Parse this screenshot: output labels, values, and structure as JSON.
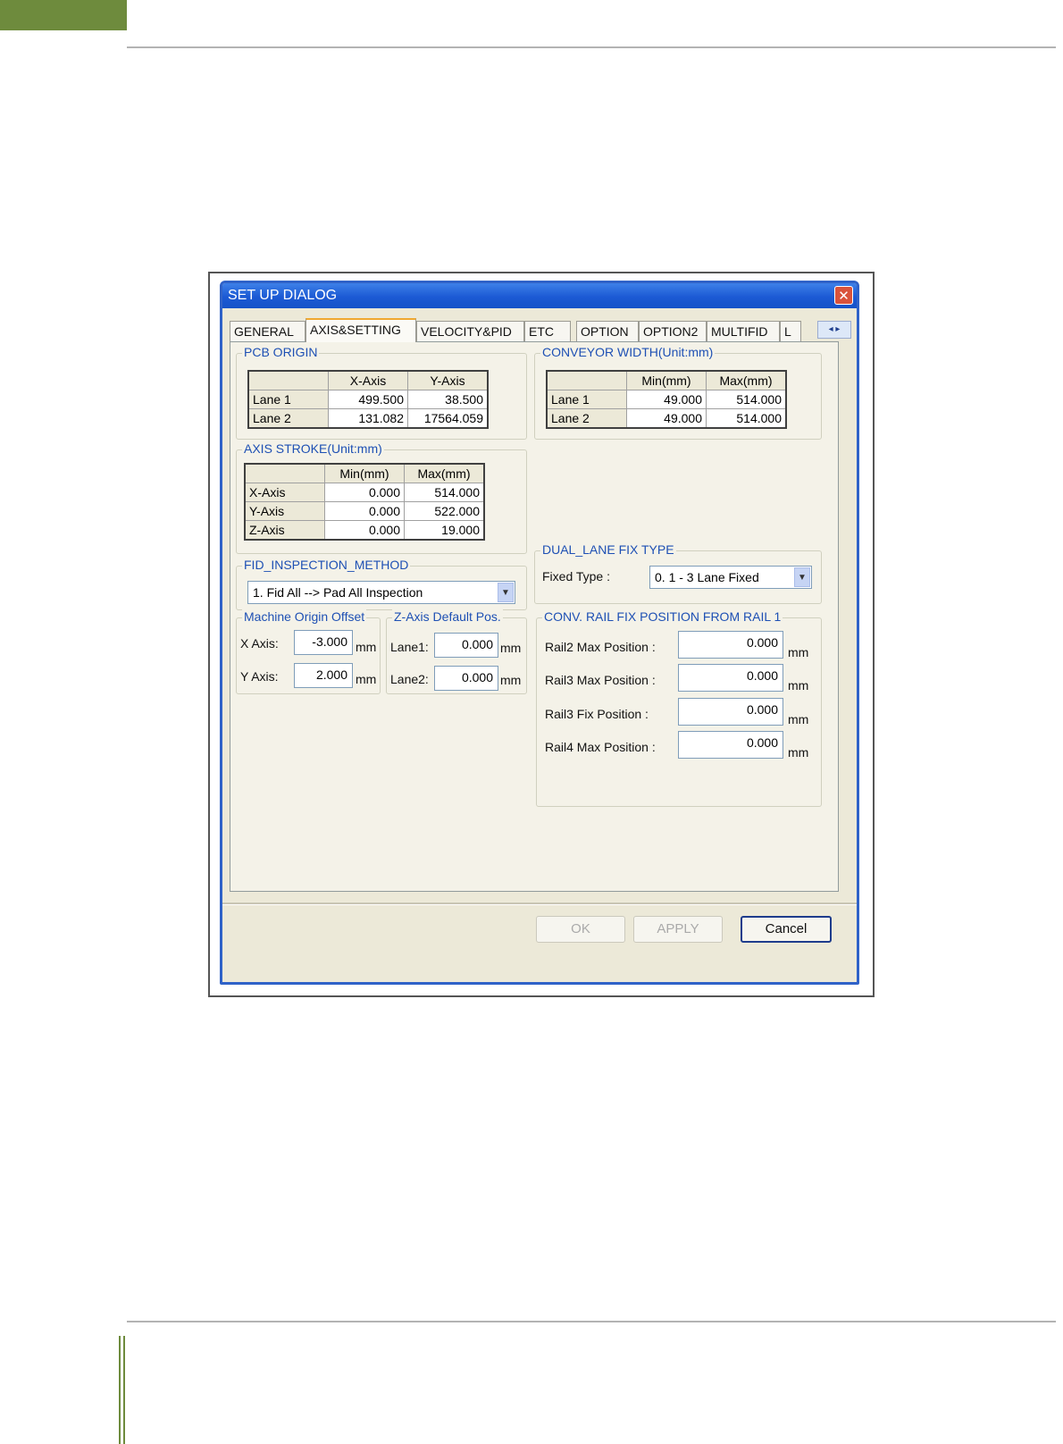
{
  "dialog": {
    "title": "SET UP DIALOG",
    "tabs": [
      "GENERAL",
      "AXIS&SETTING",
      "VELOCITY&PID",
      "ETC",
      "OPTION",
      "OPTION2",
      "MULTIFID",
      "L"
    ],
    "active_tab": "AXIS&SETTING",
    "tab_scroll": "◂ ▸"
  },
  "pcb_origin": {
    "label": "PCB ORIGIN",
    "columns": [
      "",
      "X-Axis",
      "Y-Axis"
    ],
    "rows": [
      [
        "Lane 1",
        "499.500",
        "38.500"
      ],
      [
        "Lane 2",
        "131.082",
        "17564.059"
      ]
    ]
  },
  "conveyor_width": {
    "label": "CONVEYOR WIDTH(Unit:mm)",
    "columns": [
      "",
      "Min(mm)",
      "Max(mm)"
    ],
    "rows": [
      [
        "Lane 1",
        "49.000",
        "514.000"
      ],
      [
        "Lane 2",
        "49.000",
        "514.000"
      ]
    ]
  },
  "axis_stroke": {
    "label": "AXIS STROKE(Unit:mm)",
    "columns": [
      "",
      "Min(mm)",
      "Max(mm)"
    ],
    "rows": [
      [
        "X-Axis",
        "0.000",
        "514.000"
      ],
      [
        "Y-Axis",
        "0.000",
        "522.000"
      ],
      [
        "Z-Axis",
        "0.000",
        "19.000"
      ]
    ]
  },
  "fid_inspection": {
    "label": "FID_INSPECTION_METHOD",
    "selected": "1. Fid All --> Pad All Inspection"
  },
  "dual_lane": {
    "label": "DUAL_LANE FIX TYPE",
    "field_label": "Fixed Type :",
    "selected": "0. 1 - 3 Lane Fixed"
  },
  "machine_origin": {
    "label": "Machine Origin Offset",
    "x_label": "X Axis:",
    "x_value": "-3.000",
    "y_label": "Y Axis:",
    "y_value": "2.000",
    "unit": "mm"
  },
  "z_axis_default": {
    "label": "Z-Axis Default Pos.",
    "lane1_label": "Lane1:",
    "lane1_value": "0.000",
    "lane2_label": "Lane2:",
    "lane2_value": "0.000",
    "unit": "mm"
  },
  "conv_rail": {
    "label": "CONV. RAIL FIX POSITION FROM RAIL 1",
    "unit": "mm",
    "items": [
      {
        "label": "Rail2 Max Position :",
        "value": "0.000"
      },
      {
        "label": "Rail3 Max Position :",
        "value": "0.000"
      },
      {
        "label": "Rail3 Fix Position :",
        "value": "0.000"
      },
      {
        "label": "Rail4 Max Position :",
        "value": "0.000"
      }
    ]
  },
  "buttons": {
    "ok": "OK",
    "apply": "APPLY",
    "cancel": "Cancel"
  },
  "icons": {
    "close": "close-icon",
    "dropdown": "chevron-down-icon"
  },
  "colors": {
    "title_bar": "#1c5ad4",
    "group_label": "#1e50b4",
    "accent_green": "#6e8b3d",
    "active_tab_top": "#f0a830"
  }
}
